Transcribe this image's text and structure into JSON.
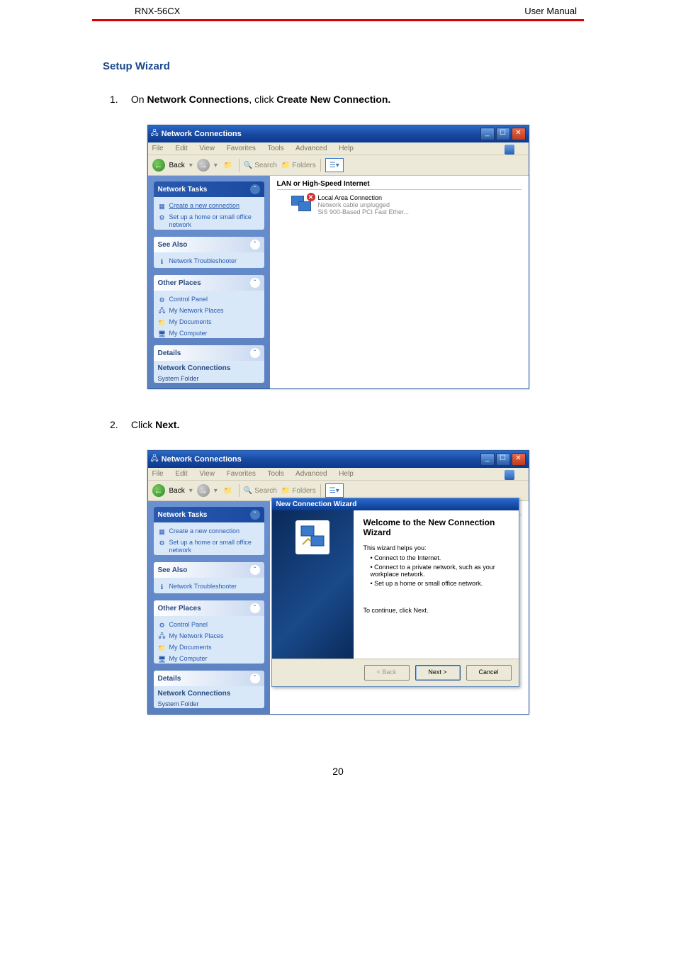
{
  "header": {
    "left": "RNX-56CX",
    "right": "User  Manual"
  },
  "section_title": "Setup Wizard",
  "step1": {
    "num": "1.",
    "word1": "On",
    "bold1": "Network Connections",
    "word2": ", click",
    "bold2": "Create New Connection",
    "dot": "."
  },
  "step2": {
    "num": "2.",
    "word1": "Click",
    "bold1": "Next",
    "dot": "."
  },
  "titlebar": "Network Connections",
  "menus": [
    "File",
    "Edit",
    "View",
    "Favorites",
    "Tools",
    "Advanced",
    "Help"
  ],
  "toolbar": {
    "back": "Back",
    "fwd_glyph": "→",
    "back_glyph": "←",
    "up_glyph": "📁↑",
    "search": "Search",
    "folders": "Folders",
    "views_glyph": "☰▾"
  },
  "panels": {
    "tasks": {
      "title": "Network Tasks",
      "items": [
        {
          "icon": "new-conn",
          "text": "Create a new connection"
        },
        {
          "icon": "home-net",
          "text": "Set up a home or small office network"
        }
      ]
    },
    "seealso": {
      "title": "See Also",
      "items": [
        {
          "icon": "trouble",
          "text": "Network Troubleshooter"
        }
      ]
    },
    "other": {
      "title": "Other Places",
      "items": [
        {
          "icon": "ctrl",
          "text": "Control Panel"
        },
        {
          "icon": "netplaces",
          "text": "My Network Places"
        },
        {
          "icon": "docs",
          "text": "My Documents"
        },
        {
          "icon": "comp",
          "text": "My Computer"
        }
      ]
    },
    "details": {
      "title": "Details",
      "h": "Network Connections",
      "sub": "System Folder"
    }
  },
  "content": {
    "group": "LAN or High-Speed Internet",
    "item": {
      "t1": "Local Area Connection",
      "t2": "Network cable unplugged",
      "t3": "SiS 900-Based PCI Fast Ether..."
    }
  },
  "wizard": {
    "title": "New Connection Wizard",
    "heading": "Welcome to the New Connection Wizard",
    "p1": "This wizard helps you:",
    "li1": "Connect to the Internet.",
    "li2": "Connect to a private network, such as your workplace network.",
    "li3": "Set up a home or small office network.",
    "cont": "To continue, click Next.",
    "back": "< Back",
    "next": "Next >",
    "cancel": "Cancel"
  },
  "page_num": "20"
}
